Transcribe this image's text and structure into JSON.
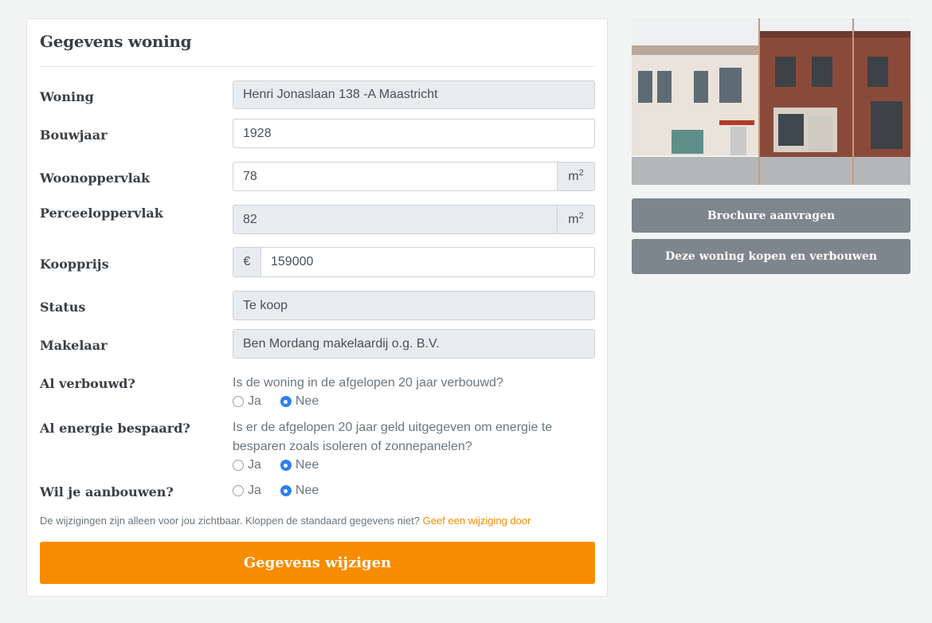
{
  "form": {
    "title": "Gegevens woning",
    "woning": {
      "label": "Woning",
      "value": "Henri Jonaslaan 138 -A Maastricht"
    },
    "bouwjaar": {
      "label": "Bouwjaar",
      "value": "1928"
    },
    "woonoppervlak": {
      "label": "Woonoppervlak",
      "value": "78",
      "unit": "m",
      "unit_sup": "2"
    },
    "perceeloppervlak": {
      "label": "Perceeloppervlak",
      "value": "82",
      "unit": "m",
      "unit_sup": "2"
    },
    "koopprijs": {
      "label": "Koopprijs",
      "currency": "€",
      "value": "159000"
    },
    "status": {
      "label": "Status",
      "value": "Te koop"
    },
    "makelaar": {
      "label": "Makelaar",
      "value": "Ben Mordang makelaardij o.g. B.V."
    },
    "verbouwd": {
      "label": "Al verbouwd?",
      "question": "Is de woning in de afgelopen 20 jaar verbouwd?",
      "option_yes": "Ja",
      "option_no": "Nee",
      "selected": "Nee"
    },
    "energie": {
      "label": "Al energie bespaard?",
      "question_line1": "Is er de afgelopen 20 jaar geld uitgegeven om energie te",
      "question_line2": "besparen zoals isoleren of zonnepanelen?",
      "option_yes": "Ja",
      "option_no": "Nee",
      "selected": "Nee"
    },
    "aanbouwen": {
      "label": "Wil je aanbouwen?",
      "option_yes": "Ja",
      "option_no": "Nee",
      "selected": "Nee"
    },
    "note_text": "De wijzigingen zijn alleen voor jou zichtbaar. Kloppen de standaard gegevens niet?",
    "note_link": "Geef een wijziging door",
    "submit_label": "Gegevens wijzigen"
  },
  "sidebar": {
    "brochure_label": "Brochure aanvragen",
    "buy_label": "Deze woning kopen en verbouwen"
  },
  "colors": {
    "accent": "#f88c00",
    "secondary_button": "#7d858d",
    "radio_selected": "#2f80ed"
  }
}
